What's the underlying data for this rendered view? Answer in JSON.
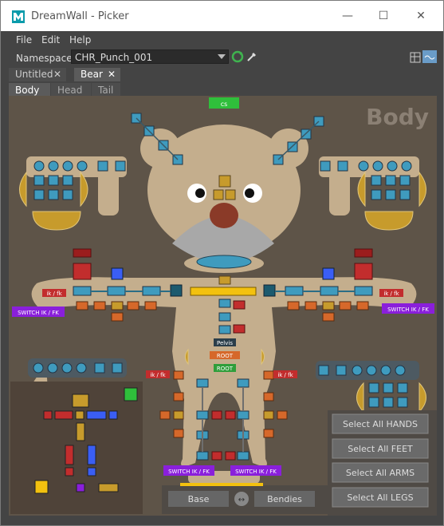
{
  "window": {
    "title": "DreamWall - Picker",
    "minimize": "—",
    "maximize": "☐",
    "close": "✕"
  },
  "menubar": {
    "items": [
      "File",
      "Edit",
      "Help"
    ]
  },
  "namespace": {
    "label": "Namespace:",
    "value": "CHR_Punch_001"
  },
  "tabs": [
    {
      "label": "Untitled",
      "close": "✕"
    },
    {
      "label": "Bear",
      "close": "✕"
    }
  ],
  "subtabs": [
    "Body",
    "Head",
    "Tail"
  ],
  "picker": {
    "watermark": "Body",
    "cs_label": "cs",
    "ikfk_small": "ik / fk",
    "switch_ikfk": "SWITCH IK / FK",
    "pelvis_label": "Pelvis",
    "root_label": "ROOT",
    "root2_label": "ROOT",
    "select_all": [
      "Select All HANDS",
      "Select All FEET",
      "Select All ARMS",
      "Select All LEGS"
    ],
    "base_label": "Base",
    "bendies_label": "Bendies"
  },
  "colors": {
    "panel": "#5e5448",
    "bear": "#c4ae8d",
    "teal": "#3f9bbe",
    "yellow": "#f3c10f",
    "red_ctrl": "#c22d2d",
    "orange_ctrl": "#d6682a",
    "purple": "#8a1fdb",
    "gold": "#c79b2c",
    "green": "#2fbf3b"
  }
}
